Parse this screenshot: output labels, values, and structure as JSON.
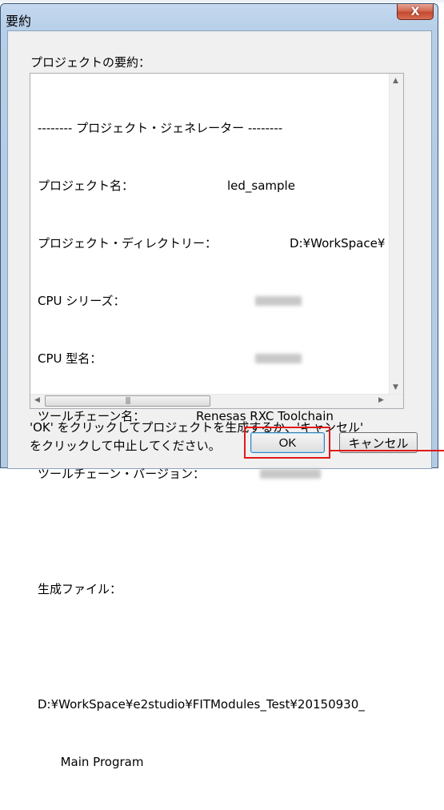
{
  "dialog": {
    "title": "要約",
    "close_label": "X",
    "summary_label": "プロジェクトの要約：",
    "summary_lines": [
      "-------- プロジェクト・ジェネレーター --------",
      "プロジェクト名：",
      "プロジェクト・ディレクトリー：",
      "CPU シリーズ：",
      "CPU 型名：",
      "ツールチェーン名：",
      "ツールチェーン・バージョン：",
      "",
      "生成ファイル：",
      "",
      "D:¥WorkSpace¥e2studio¥FITModules_Test¥20150930_",
      "      Main Program"
    ],
    "summary_values": {
      "project_name": "led_sample",
      "project_dir": "D:¥WorkSpace¥",
      "toolchain_name": "Renesas RXC Toolchain"
    },
    "message_line1": "'OK' をクリックしてプロジェクトを生成するか、'キャンセル'",
    "message_line2": "をクリックして中止してください。",
    "ok_label": "OK",
    "cancel_label": "キャンセル"
  },
  "colors": {
    "highlight": "#e01919",
    "close_button": "#c44a31",
    "title_bar": "#b7cfe9"
  }
}
